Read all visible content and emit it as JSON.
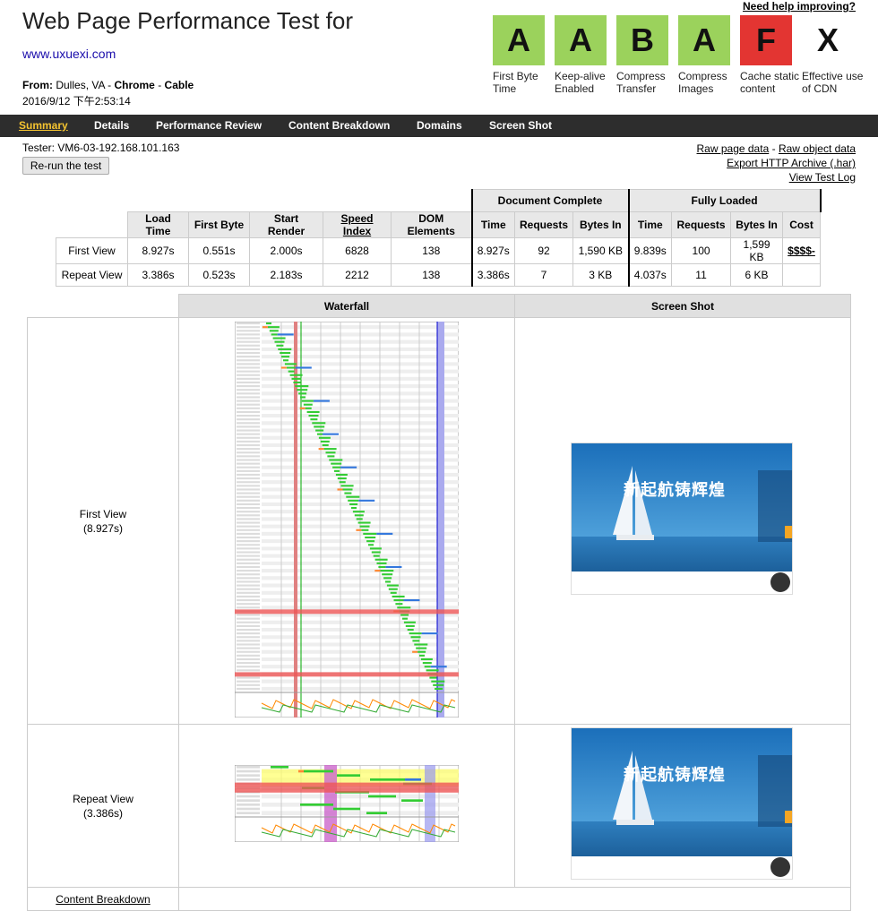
{
  "header": {
    "title": "Web Page Performance Test for",
    "url": "www.uxuexi.com",
    "from_label": "From:",
    "from_location": "Dulles, VA -",
    "browser": "Chrome",
    "sep": "-",
    "connection": "Cable",
    "date": "2016/9/12 下午2:53:14",
    "help_link": "Need help improving?"
  },
  "grades": [
    {
      "grade": "A",
      "label": "First Byte Time",
      "color": "#9bd25c"
    },
    {
      "grade": "A",
      "label": "Keep-alive Enabled",
      "color": "#9bd25c"
    },
    {
      "grade": "B",
      "label": "Compress Transfer",
      "color": "#9bd25c"
    },
    {
      "grade": "A",
      "label": "Compress Images",
      "color": "#9bd25c"
    },
    {
      "grade": "F",
      "label": "Cache static content",
      "color": "#e33532"
    },
    {
      "grade": "X",
      "label": "Effective use of CDN",
      "color": "#ffffff"
    }
  ],
  "nav": {
    "items": [
      "Summary",
      "Details",
      "Performance Review",
      "Content Breakdown",
      "Domains",
      "Screen Shot"
    ],
    "active": "Summary"
  },
  "tester": "Tester: VM6-03-192.168.101.163",
  "rerun_label": "Re-run the test",
  "links": {
    "raw_page": "Raw page data",
    "dash": "-",
    "raw_object": "Raw object data",
    "export_har": "Export HTTP Archive (.har)",
    "view_log": "View Test Log"
  },
  "results": {
    "group_doc": "Document Complete",
    "group_full": "Fully Loaded",
    "columns": [
      "Load Time",
      "First Byte",
      "Start Render",
      "Speed Index",
      "DOM Elements",
      "Time",
      "Requests",
      "Bytes In",
      "Time",
      "Requests",
      "Bytes In",
      "Cost"
    ],
    "rows": [
      {
        "label": "First View",
        "values": [
          "8.927s",
          "0.551s",
          "2.000s",
          "6828",
          "138",
          "8.927s",
          "92",
          "1,590 KB",
          "9.839s",
          "100",
          "1,599 KB",
          "$$$$-"
        ]
      },
      {
        "label": "Repeat View",
        "values": [
          "3.386s",
          "0.523s",
          "2.183s",
          "2212",
          "138",
          "3.386s",
          "7",
          "3 KB",
          "4.037s",
          "11",
          "6 KB",
          ""
        ]
      }
    ]
  },
  "waterfall": {
    "col_waterfall": "Waterfall",
    "col_screenshot": "Screen Shot",
    "first_view_label": "First View",
    "first_view_time": "(8.927s)",
    "repeat_view_label": "Repeat View",
    "repeat_view_time": "(3.386s)",
    "content_breakdown_link": "Content Breakdown",
    "screenshot_headline": "新起航铸辉煌"
  }
}
